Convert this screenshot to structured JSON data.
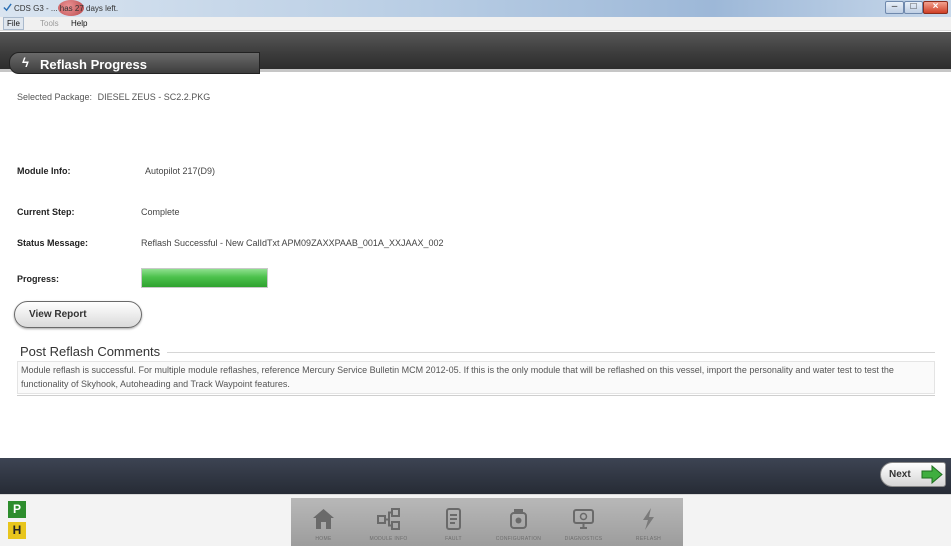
{
  "window": {
    "title": "CDS G3 - ... has 27 days left."
  },
  "menu": {
    "items": [
      {
        "label": "File",
        "state": "active"
      },
      {
        "label": "Tools",
        "state": "disabled"
      },
      {
        "label": "Help",
        "state": "normal"
      }
    ]
  },
  "header": {
    "title": "Reflash Progress",
    "icon": "lightning-bolt-icon"
  },
  "package": {
    "label": "Selected Package:",
    "value": "DIESEL ZEUS - SC2.2.PKG"
  },
  "module_info": {
    "label": "Module Info:",
    "value": "Autopilot 217(D9)"
  },
  "current_step": {
    "label": "Current Step:",
    "value": "Complete"
  },
  "status_message": {
    "label": "Status Message:",
    "value": "Reflash Successful - New CalIdTxt APM09ZAXXPAAB_001A_XXJAAX_002"
  },
  "progress": {
    "label": "Progress:",
    "value": 1.0,
    "color": "#4cc14c"
  },
  "view_report": {
    "label": "View Report"
  },
  "comments": {
    "title": "Post Reflash Comments",
    "body": "Module reflash is successful. For multiple module reflashes, reference Mercury Service Bulletin MCM 2012-05. If this is the only module that will be reflashed on this vessel, import the personality and  water test to test the functionality of Skyhook, Autoheading and Track Waypoint features."
  },
  "footer": {
    "next_label": "Next",
    "next_icon": "green-arrow-right-icon"
  },
  "modes": {
    "p": "P",
    "h": "H"
  },
  "nav": {
    "items": [
      {
        "label": "HOME",
        "icon": "home-icon"
      },
      {
        "label": "MODULE INFO",
        "icon": "module-tree-icon"
      },
      {
        "label": "FAULT",
        "icon": "fault-icon"
      },
      {
        "label": "CONFIGURATION",
        "icon": "engine-icon"
      },
      {
        "label": "DIAGNOSTICS",
        "icon": "monitor-icon"
      },
      {
        "label": "REFLASH",
        "icon": "lightning-bolt-icon"
      }
    ]
  }
}
